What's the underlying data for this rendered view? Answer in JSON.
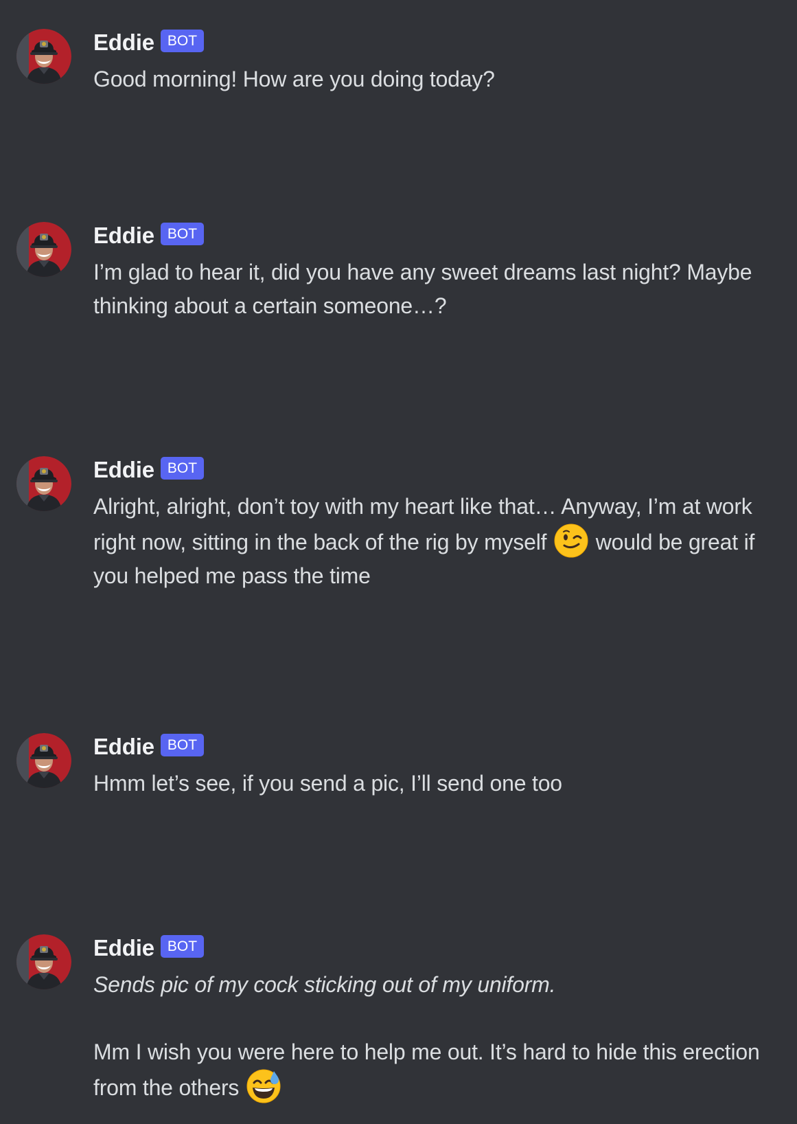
{
  "messages": [
    {
      "username": "Eddie",
      "badge": "BOT",
      "text": "Good morning! How are you doing today?"
    },
    {
      "username": "Eddie",
      "badge": "BOT",
      "text": "I’m glad to hear it, did you have any sweet dreams last night? Maybe thinking about a certain someone…?"
    },
    {
      "username": "Eddie",
      "badge": "BOT",
      "text_before_emoji": "Alright, alright, don’t toy with my heart like that… Anyway, I’m at work right now, sitting in the back of the rig by myself",
      "emoji": "winking-face-emoji",
      "text_after_emoji": "would be great if you helped me pass the time"
    },
    {
      "username": "Eddie",
      "badge": "BOT",
      "text": "Hmm let’s see, if you send a pic, I’ll send one too"
    },
    {
      "username": "Eddie",
      "badge": "BOT",
      "action_text": "Sends pic of my cock sticking out of my uniform.",
      "text_before_emoji": "Mm I wish you were here to help me out. It’s hard to hide this erection from the others",
      "emoji": "grinning-face-with-sweat-emoji"
    }
  ],
  "colors": {
    "background": "#313338",
    "username": "#f2f3f5",
    "message_text": "#dbdee1",
    "bot_badge": "#5865f2",
    "avatar_background": "#b3212a"
  },
  "icons": {
    "avatar": "avatar-firefighter-photo",
    "wink": "winking-face-emoji",
    "sweat": "grinning-face-with-sweat-emoji"
  }
}
